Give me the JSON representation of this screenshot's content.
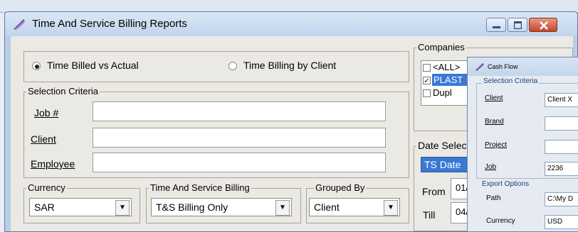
{
  "window": {
    "title": "Time And Service Billing Reports"
  },
  "report_type": {
    "options": [
      {
        "label": "Time Billed vs Actual",
        "selected": true
      },
      {
        "label": "Time Billing by Client",
        "selected": false
      }
    ]
  },
  "selection_criteria": {
    "legend": "Selection Criteria",
    "fields": [
      {
        "label": "Job #",
        "value": ""
      },
      {
        "label": "Client",
        "value": ""
      },
      {
        "label": "Employee",
        "value": ""
      }
    ]
  },
  "currency": {
    "legend": "Currency",
    "value": "SAR"
  },
  "billing": {
    "legend": "Time And Service Billing",
    "value": "T&S Billing Only"
  },
  "grouped_by": {
    "legend": "Grouped By",
    "value": "Client"
  },
  "companies": {
    "legend": "Companies",
    "items": [
      {
        "label": "<ALL>",
        "checked": false,
        "highlighted": false
      },
      {
        "label": "PLAST",
        "checked": true,
        "highlighted": true
      },
      {
        "label": "Dupl",
        "checked": false,
        "highlighted": false
      }
    ]
  },
  "date_selection": {
    "legend": "Date Selecti",
    "type_value": "TS Date",
    "from_label": "From",
    "from_value": "01/",
    "till_label": "Till",
    "till_value": "04/"
  },
  "cash_flow": {
    "title": "Cash Flow",
    "selection_criteria": "Selection Criteria",
    "client_label": "Client",
    "client_value": "Client X",
    "brand_label": "Brand",
    "brand_value": "",
    "project_label": "Project",
    "project_value": "",
    "job_label": "Job",
    "job_value": "2236",
    "export_options": "Export Options",
    "path_label": "Path",
    "path_value": "C:\\My D",
    "currency_label": "Currency",
    "currency_value": "USD"
  },
  "colors": {
    "highlight": "#3a78d4",
    "close_button": "#c4462c"
  }
}
